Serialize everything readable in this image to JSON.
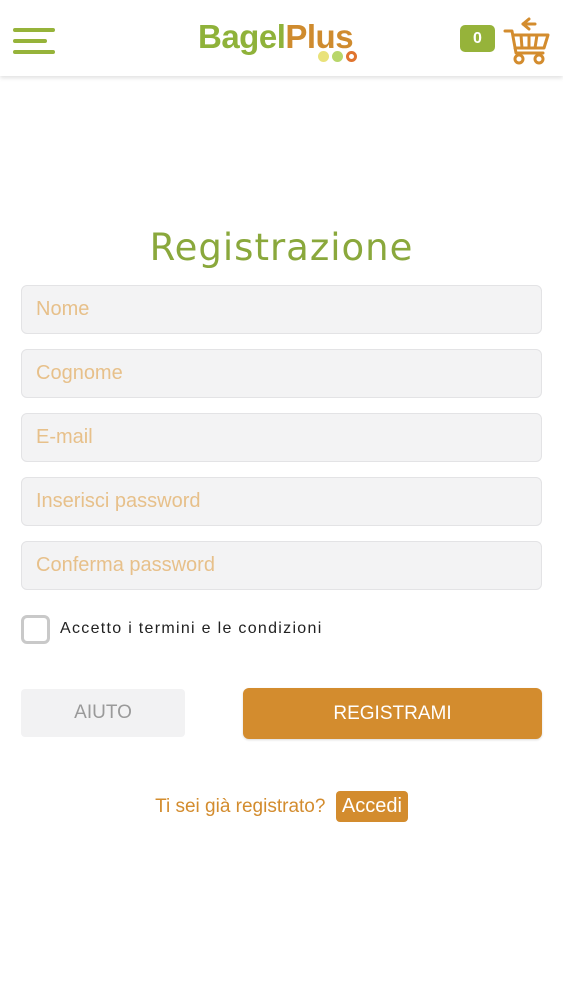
{
  "header": {
    "logo": {
      "part1": "Bagel",
      "part2": "Plus"
    },
    "cart_count": "0",
    "colors": {
      "green": "#96b33a",
      "orange": "#d38c2e"
    }
  },
  "form": {
    "title": "Registrazione",
    "fields": [
      {
        "placeholder": "Nome",
        "value": ""
      },
      {
        "placeholder": "Cognome",
        "value": ""
      },
      {
        "placeholder": "E-mail",
        "value": ""
      },
      {
        "placeholder": "Inserisci password",
        "value": ""
      },
      {
        "placeholder": "Conferma password",
        "value": ""
      }
    ],
    "terms_label": "Accetto i termini e le condizioni",
    "terms_checked": false,
    "help_button": "AIUTO",
    "register_button": "REGISTRAMI"
  },
  "login": {
    "question": "Ti sei già registrato?",
    "link": "Accedi"
  },
  "icons": [
    "menu-icon",
    "cart-icon"
  ]
}
